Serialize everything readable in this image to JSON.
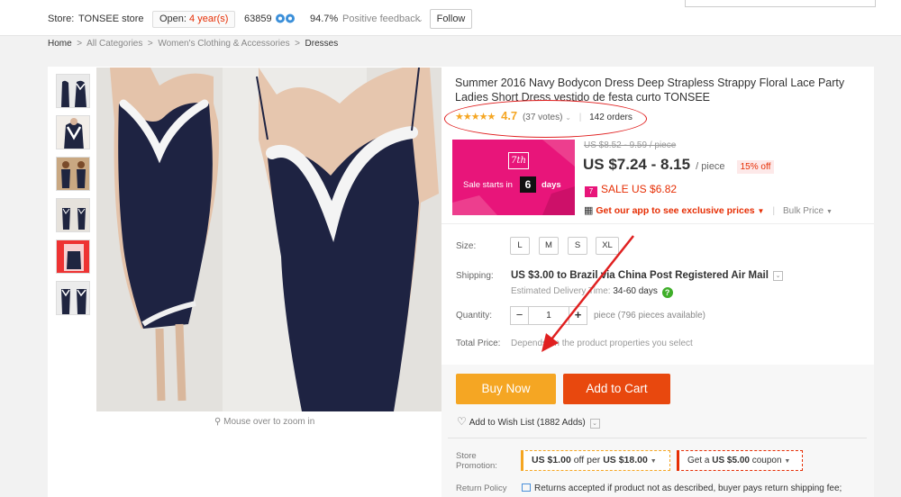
{
  "store": {
    "label": "Store:",
    "name": "TONSEE store",
    "open_label": "Open:",
    "open_years": "4 year(s)",
    "score": "63859",
    "feedback_pct": "94.7%",
    "feedback_label": "Positive feedback",
    "follow_label": "Follow"
  },
  "breadcrumb": {
    "home": "Home",
    "cat1": "All Categories",
    "cat2": "Women's Clothing & Accessories",
    "current": "Dresses"
  },
  "product": {
    "title": "Summer 2016 Navy Bodycon Dress Deep Strapless Strappy Floral Lace Party Ladies Short Dress vestido de festa curto TONSEE",
    "stars": "★★★★★",
    "rating": "4.7",
    "votes": "(37 votes)",
    "orders": "142 orders",
    "zoom_hint": "Mouse over to zoom in"
  },
  "promo_banner": {
    "badge": "7th",
    "text": "Sale starts in",
    "day": "6",
    "days_label": "days",
    "bg_color": "#e8157a"
  },
  "price": {
    "old": "US $8.52 - 9.59 / piece",
    "current": "US $7.24 - 8.15",
    "unit": "/ piece",
    "discount": "15% off",
    "sale": "SALE US $6.82",
    "app_promo": "Get our app to see exclusive prices",
    "bulk": "Bulk Price"
  },
  "options": {
    "size_label": "Size:",
    "sizes": [
      "L",
      "M",
      "S",
      "XL"
    ],
    "shipping_label": "Shipping:",
    "shipping_value": "US $3.00 to Brazil via China Post Registered Air Mail",
    "delivery_label": "Estimated Delivery Time:",
    "delivery_value": "34-60 days",
    "quantity_label": "Quantity:",
    "quantity_value": "1",
    "minus": "−",
    "plus": "+",
    "availability": "piece (796 pieces available)",
    "total_label": "Total Price:",
    "total_value": "Depends on the product properties you select"
  },
  "actions": {
    "buy_now": "Buy Now",
    "add_to_cart": "Add to Cart",
    "wishlist": "Add to Wish List (1882 Adds)"
  },
  "store_promotion": {
    "label_line1": "Store",
    "label_line2": "Promotion:",
    "coupon1_amount": "US $1.00",
    "coupon1_per": "off per",
    "coupon1_min": "US $18.00",
    "coupon2_prefix": "Get a",
    "coupon2_amount": "US $5.00",
    "coupon2_suffix": "coupon"
  },
  "return_policy": {
    "label": "Return Policy",
    "text": "Returns accepted if product not as described, buyer pays return shipping fee;"
  },
  "colors": {
    "accent_red": "#e62e04",
    "buy_orange": "#f5a623",
    "cart_red": "#e8480e",
    "annotation_red": "#e02020"
  }
}
